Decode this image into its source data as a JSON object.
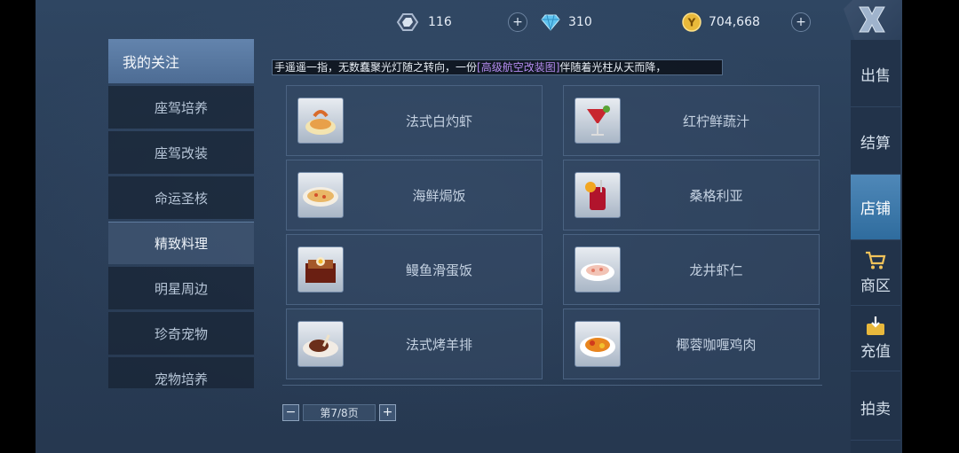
{
  "topbar": {
    "currencies": [
      {
        "icon": "shield-crystal-icon",
        "value": "116"
      },
      {
        "icon": "diamond-icon",
        "value": "310"
      },
      {
        "icon": "coin-icon",
        "value": "704,668"
      }
    ],
    "close_icon": "close-icon"
  },
  "categories": {
    "header": "我的关注",
    "items": [
      {
        "label": "座驾培养"
      },
      {
        "label": "座驾改装"
      },
      {
        "label": "命运圣核"
      },
      {
        "label": "精致料理",
        "active": true
      },
      {
        "label": "明星周边"
      },
      {
        "label": "珍奇宠物"
      },
      {
        "label": "宠物培养"
      }
    ]
  },
  "marquee": {
    "before": "手遥遥一指，无数蠢聚光灯随之转向，一份",
    "highlight": "[高级航空改装图]",
    "after": "伴随着光柱从天而降，"
  },
  "items": [
    {
      "name": "法式白灼虾",
      "icon": "shrimp-dish-icon"
    },
    {
      "name": "红柠鲜蔬汁",
      "icon": "red-cocktail-icon"
    },
    {
      "name": "海鲜焗饭",
      "icon": "baked-rice-icon"
    },
    {
      "name": "桑格利亚",
      "icon": "sangria-icon"
    },
    {
      "name": "鳗鱼滑蛋饭",
      "icon": "eel-rice-box-icon"
    },
    {
      "name": "龙井虾仁",
      "icon": "shrimp-plate-icon"
    },
    {
      "name": "法式烤羊排",
      "icon": "lamb-chop-icon"
    },
    {
      "name": "椰蓉咖喱鸡肉",
      "icon": "curry-chicken-icon"
    }
  ],
  "pager": {
    "label": "第7/8页",
    "prev": "−",
    "next": "+"
  },
  "right_nav": [
    {
      "label": "出售"
    },
    {
      "label": "结算"
    },
    {
      "label": "店铺",
      "active": true
    },
    {
      "label": "商区",
      "icon": "cart-icon"
    },
    {
      "label": "充值",
      "icon": "recharge-icon"
    },
    {
      "label": "拍卖"
    }
  ],
  "colors": {
    "accent": "#3f7fb5",
    "highlight_text": "#b58cf0",
    "panel": "#2c4160"
  }
}
